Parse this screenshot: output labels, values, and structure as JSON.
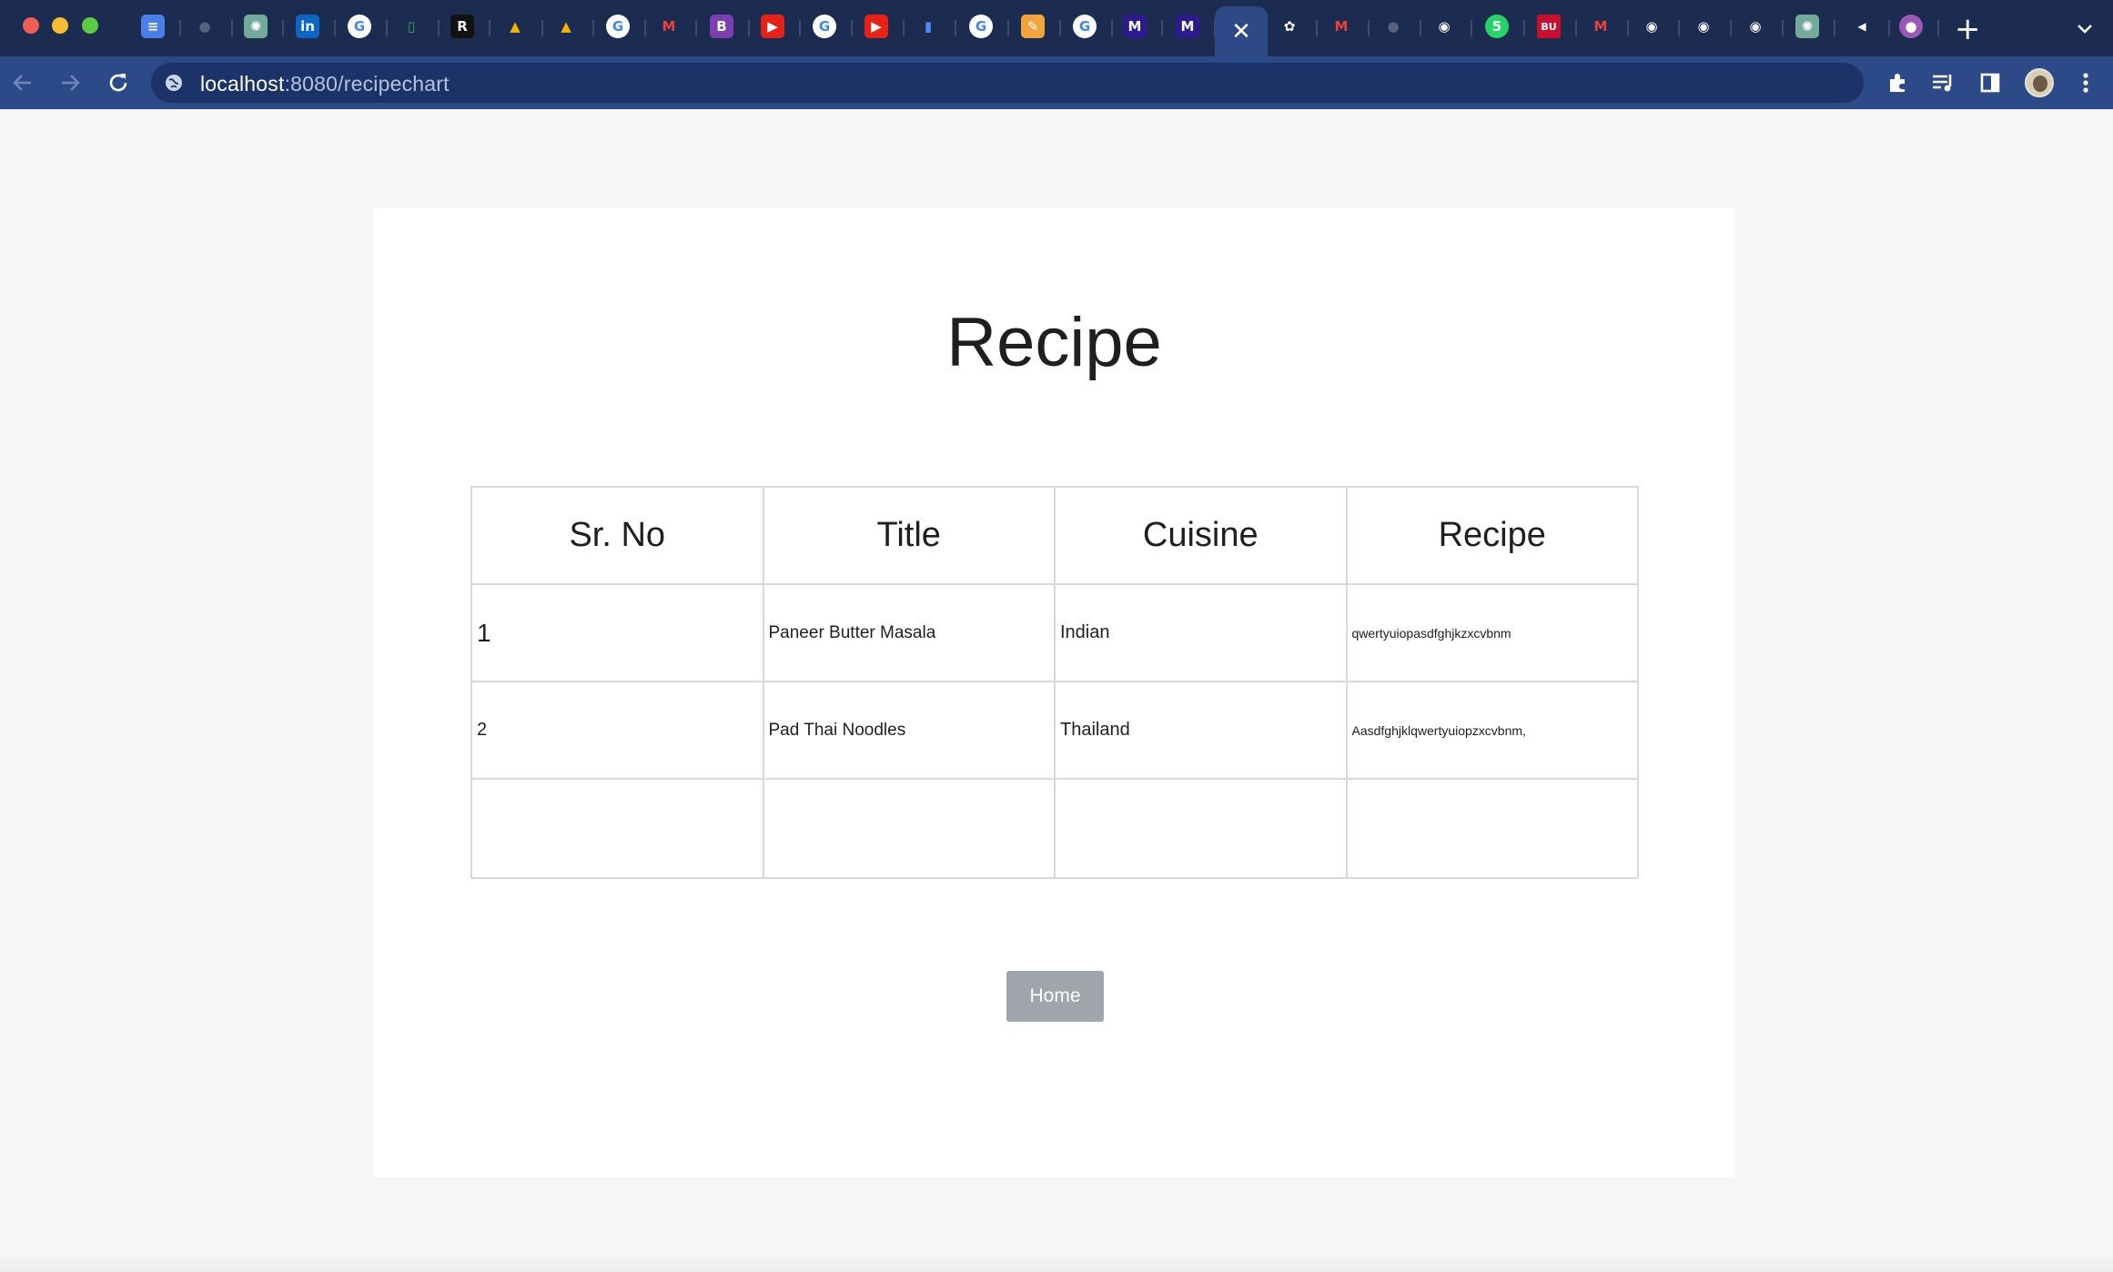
{
  "browser": {
    "url_host": "localhost",
    "url_rest": ":8080/recipechart",
    "active_tab_close": "✕",
    "new_tab": "+",
    "tabs": [
      {
        "icon": "docs-icon",
        "glyph": "≡",
        "bg": "#4a7ee8"
      },
      {
        "icon": "github-icon",
        "glyph": "●",
        "bg": "#1c2b50"
      },
      {
        "icon": "chatgpt-icon",
        "glyph": "✺",
        "bg": "#74aa9c"
      },
      {
        "icon": "linkedin-icon",
        "glyph": "in",
        "bg": "#0a66c2"
      },
      {
        "icon": "google-icon",
        "glyph": "G",
        "bg": "#ffffff"
      },
      {
        "icon": "sheets-icon",
        "glyph": "▯",
        "bg": "#1c2b50"
      },
      {
        "icon": "r-icon",
        "glyph": "R",
        "bg": "#111111"
      },
      {
        "icon": "drive-icon",
        "glyph": "▲",
        "bg": "#1c2b50"
      },
      {
        "icon": "drive-icon",
        "glyph": "▲",
        "bg": "#1c2b50"
      },
      {
        "icon": "google-icon",
        "glyph": "G",
        "bg": "#ffffff"
      },
      {
        "icon": "gmail-icon",
        "glyph": "M",
        "bg": "#1c2b50"
      },
      {
        "icon": "bootstrap-icon",
        "glyph": "B",
        "bg": "#7b3fb0"
      },
      {
        "icon": "youtube-icon",
        "glyph": "▶",
        "bg": "#e62117"
      },
      {
        "icon": "google-icon",
        "glyph": "G",
        "bg": "#ffffff"
      },
      {
        "icon": "youtube-icon",
        "glyph": "▶",
        "bg": "#e62117"
      },
      {
        "icon": "analytics-icon",
        "glyph": "▮",
        "bg": "#1c2b50"
      },
      {
        "icon": "google-icon",
        "glyph": "G",
        "bg": "#ffffff"
      },
      {
        "icon": "pencil-icon",
        "glyph": "✎",
        "bg": "#f2a33a"
      },
      {
        "icon": "google-icon",
        "glyph": "G",
        "bg": "#ffffff"
      },
      {
        "icon": "m-icon",
        "glyph": "M",
        "bg": "#2d1a8c"
      },
      {
        "icon": "m-icon",
        "glyph": "M",
        "bg": "#2d1a8c"
      },
      {
        "icon": "apps-icon",
        "glyph": "✿",
        "bg": "#1c2b50"
      },
      {
        "icon": "gmail-icon",
        "glyph": "M",
        "bg": "#1c2b50"
      },
      {
        "icon": "github-icon",
        "glyph": "●",
        "bg": "#1c2b50"
      },
      {
        "icon": "chrome-icon",
        "glyph": "◉",
        "bg": "#1c2b50"
      },
      {
        "icon": "whatsapp-icon",
        "glyph": "5",
        "bg": "#25d366"
      },
      {
        "icon": "bu-icon",
        "glyph": "BU",
        "bg": "#c8102e"
      },
      {
        "icon": "gmail-icon",
        "glyph": "M",
        "bg": "#1c2b50"
      },
      {
        "icon": "chrome-icon",
        "glyph": "◉",
        "bg": "#1c2b50"
      },
      {
        "icon": "chrome-icon",
        "glyph": "◉",
        "bg": "#1c2b50"
      },
      {
        "icon": "chrome-icon",
        "glyph": "◉",
        "bg": "#1c2b50"
      },
      {
        "icon": "chatgpt-icon",
        "glyph": "✺",
        "bg": "#74aa9c"
      },
      {
        "icon": "speaker-icon",
        "glyph": "◀",
        "bg": "#1c2b50"
      },
      {
        "icon": "planet-icon",
        "glyph": "●",
        "bg": "#9b59b6"
      }
    ]
  },
  "page": {
    "title": "Recipe",
    "table": {
      "headers": [
        "Sr. No",
        "Title",
        "Cuisine",
        "Recipe"
      ],
      "rows": [
        {
          "no": "1",
          "title": "Paneer Butter Masala",
          "cuisine": "Indian",
          "recipe": "qwertyuiopasdfghjkzxcvbnm"
        },
        {
          "no": "2",
          "title": "Pad Thai Noodles",
          "cuisine": "Thailand",
          "recipe": "Aasdfghjklqwertyuiopzxcvbnm,"
        }
      ]
    },
    "home_button": "Home"
  }
}
